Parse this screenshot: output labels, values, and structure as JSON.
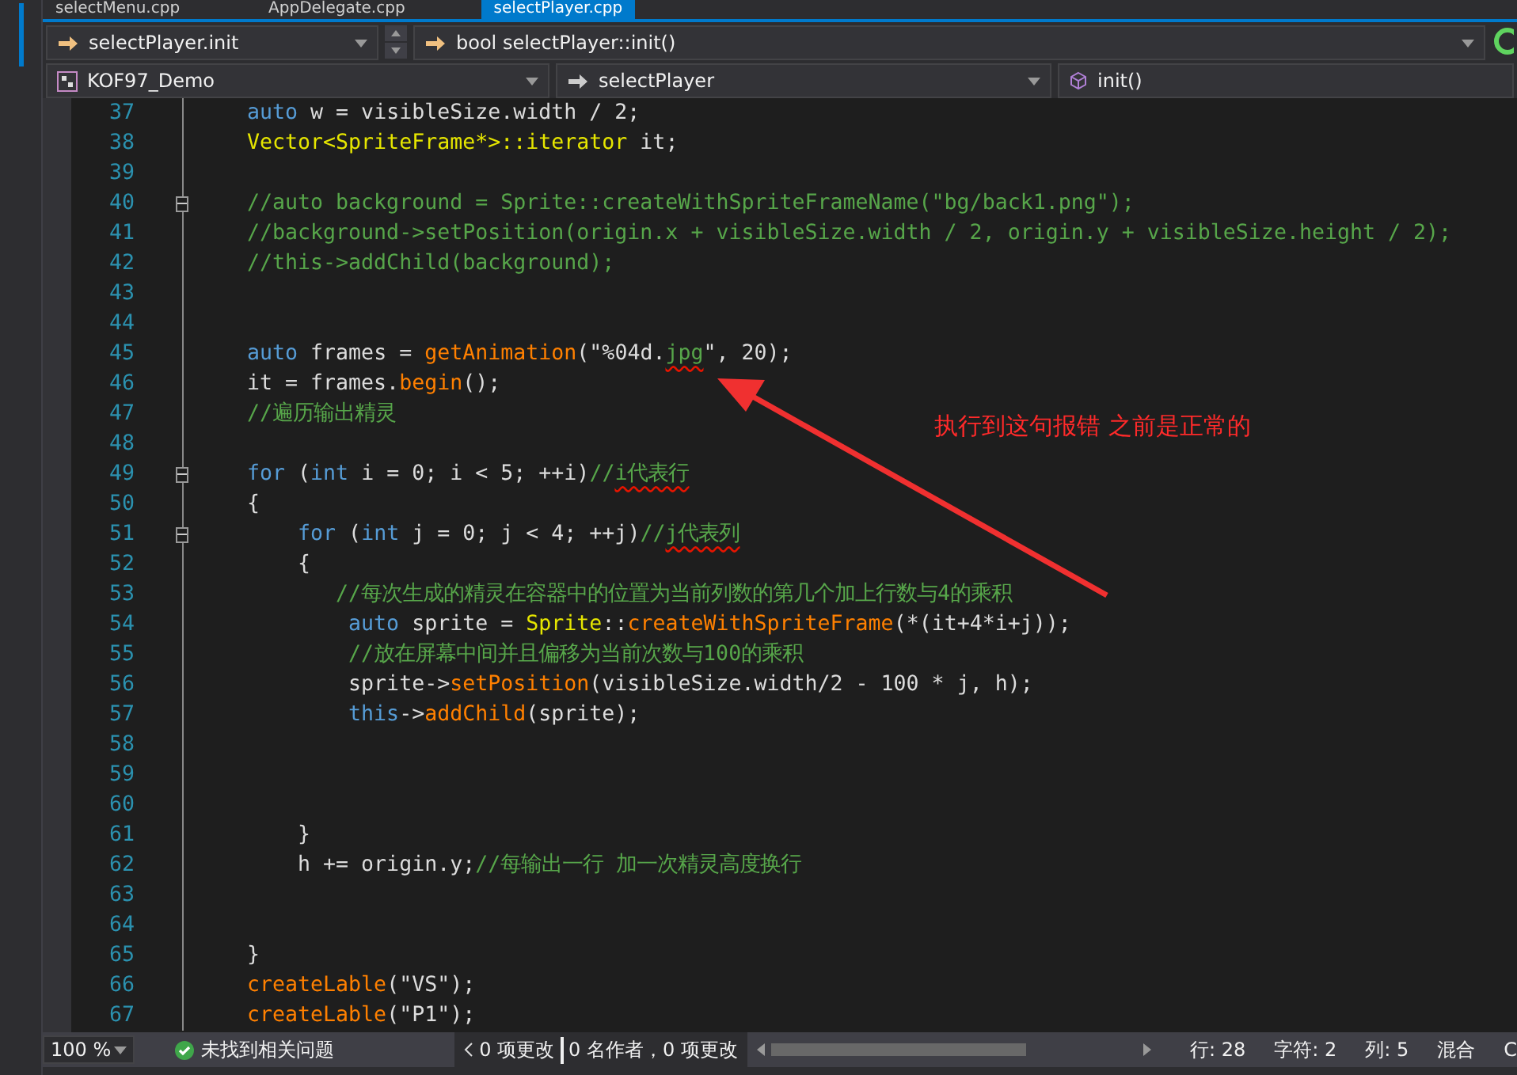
{
  "tabs": [
    {
      "label": "selectMenu.cpp",
      "selected": false
    },
    {
      "label": "AppDelegate.cpp",
      "selected": false
    },
    {
      "label": "selectPlayer.cpp",
      "selected": true
    }
  ],
  "nav": {
    "scope": "selectPlayer.init",
    "member": "bool selectPlayer::init()",
    "project": "KOF97_Demo",
    "class": "selectPlayer",
    "function": "init()"
  },
  "lines": [
    {
      "n": "37",
      "tokens": [
        {
          "kind": "kw",
          "text": "auto"
        },
        {
          "kind": "plain",
          "text": " w = visibleSize.width / 2;"
        }
      ]
    },
    {
      "n": "38",
      "tokens": [
        {
          "kind": "type",
          "text": "Vector<SpriteFrame*>::iterator"
        },
        {
          "kind": "plain",
          "text": " it;"
        }
      ]
    },
    {
      "n": "39"
    },
    {
      "n": "40",
      "fold": true,
      "tokens": [
        {
          "kind": "cm",
          "text": "//auto background = Sprite::createWithSpriteFrameName(\"bg/back1.png\");"
        }
      ]
    },
    {
      "n": "41",
      "tokens": [
        {
          "kind": "cm",
          "text": "//background->setPosition(origin.x + visibleSize.width / 2, origin.y + visibleSize.height / 2);"
        }
      ]
    },
    {
      "n": "42",
      "tokens": [
        {
          "kind": "cm",
          "text": "//this->addChild(background);"
        }
      ]
    },
    {
      "n": "43"
    },
    {
      "n": "44"
    },
    {
      "n": "45",
      "tokens": [
        {
          "kind": "kw",
          "text": "auto"
        },
        {
          "kind": "plain",
          "text": " frames = "
        },
        {
          "kind": "fn",
          "text": "getAnimation"
        },
        {
          "kind": "plain",
          "text": "(\"%04d."
        },
        {
          "kind": "err",
          "text": "jpg"
        },
        {
          "kind": "plain",
          "text": "\", 20);"
        }
      ]
    },
    {
      "n": "46",
      "tokens": [
        {
          "kind": "plain",
          "text": "it = frames."
        },
        {
          "kind": "fn",
          "text": "begin"
        },
        {
          "kind": "plain",
          "text": "();"
        }
      ]
    },
    {
      "n": "47",
      "tokens": [
        {
          "kind": "cm",
          "text": "//遍历输出精灵"
        }
      ]
    },
    {
      "n": "48"
    },
    {
      "n": "49",
      "fold": true,
      "tokens": [
        {
          "kind": "kw",
          "text": "for"
        },
        {
          "kind": "plain",
          "text": " ("
        },
        {
          "kind": "kw",
          "text": "int"
        },
        {
          "kind": "plain",
          "text": " i = 0; i < 5; ++i)"
        },
        {
          "kind": "cm",
          "text": "//"
        },
        {
          "kind": "err",
          "text": "i代表行"
        }
      ]
    },
    {
      "n": "50",
      "tokens": [
        {
          "kind": "plain",
          "text": "{"
        }
      ]
    },
    {
      "n": "51",
      "fold": true,
      "tokens": [
        {
          "kind": "kw",
          "text": "    for"
        },
        {
          "kind": "plain",
          "text": " ("
        },
        {
          "kind": "kw",
          "text": "int"
        },
        {
          "kind": "plain",
          "text": " j = 0; j < 4; ++j)"
        },
        {
          "kind": "cm",
          "text": "//"
        },
        {
          "kind": "err",
          "text": "j代表列"
        }
      ]
    },
    {
      "n": "52",
      "tokens": [
        {
          "kind": "plain",
          "text": "    {"
        }
      ]
    },
    {
      "n": "53",
      "tokens": [
        {
          "kind": "cm",
          "text": "       //每次生成的精灵在容器中的位置为当前列数的第几个加上行数与4的乘积"
        }
      ]
    },
    {
      "n": "54",
      "tokens": [
        {
          "kind": "kw",
          "text": "        auto"
        },
        {
          "kind": "plain",
          "text": " sprite = "
        },
        {
          "kind": "type",
          "text": "Sprite"
        },
        {
          "kind": "plain",
          "text": "::"
        },
        {
          "kind": "fn",
          "text": "createWithSpriteFrame"
        },
        {
          "kind": "plain",
          "text": "(*(it+4*i+j));"
        }
      ]
    },
    {
      "n": "55",
      "tokens": [
        {
          "kind": "cm",
          "text": "        //放在屏幕中间并且偏移为当前次数与100的乘积"
        }
      ]
    },
    {
      "n": "56",
      "tokens": [
        {
          "kind": "plain",
          "text": "        sprite->"
        },
        {
          "kind": "fn",
          "text": "setPosition"
        },
        {
          "kind": "plain",
          "text": "(visibleSize.width/2 - 100 * j, h);"
        }
      ]
    },
    {
      "n": "57",
      "tokens": [
        {
          "kind": "kw",
          "text": "        this"
        },
        {
          "kind": "plain",
          "text": "->"
        },
        {
          "kind": "fn",
          "text": "addChild"
        },
        {
          "kind": "plain",
          "text": "(sprite);"
        }
      ]
    },
    {
      "n": "58"
    },
    {
      "n": "59"
    },
    {
      "n": "60"
    },
    {
      "n": "61",
      "tokens": [
        {
          "kind": "plain",
          "text": "    }"
        }
      ]
    },
    {
      "n": "62",
      "tokens": [
        {
          "kind": "plain",
          "text": "    h += origin.y;"
        },
        {
          "kind": "cm",
          "text": "//每输出一行 加一次精灵高度换行"
        }
      ]
    },
    {
      "n": "63"
    },
    {
      "n": "64"
    },
    {
      "n": "65",
      "tokens": [
        {
          "kind": "plain",
          "text": "}"
        }
      ]
    },
    {
      "n": "66",
      "tokens": [
        {
          "kind": "fn",
          "text": "createLable"
        },
        {
          "kind": "plain",
          "text": "(\"VS\");"
        }
      ]
    },
    {
      "n": "67",
      "tokens": [
        {
          "kind": "fn",
          "text": "createLable"
        },
        {
          "kind": "plain",
          "text": "(\"P1\");"
        }
      ]
    }
  ],
  "annotation": {
    "text": "执行到这句报错 之前是正常的"
  },
  "status": {
    "zoom": "100 %",
    "issues": "未找到相关问题",
    "changes": "0 项更改",
    "authors": "0 名作者，0 项更改",
    "line": "行: 28",
    "char": "字符: 2",
    "col": "列: 5",
    "tabs": "混合",
    "ending": "C"
  }
}
